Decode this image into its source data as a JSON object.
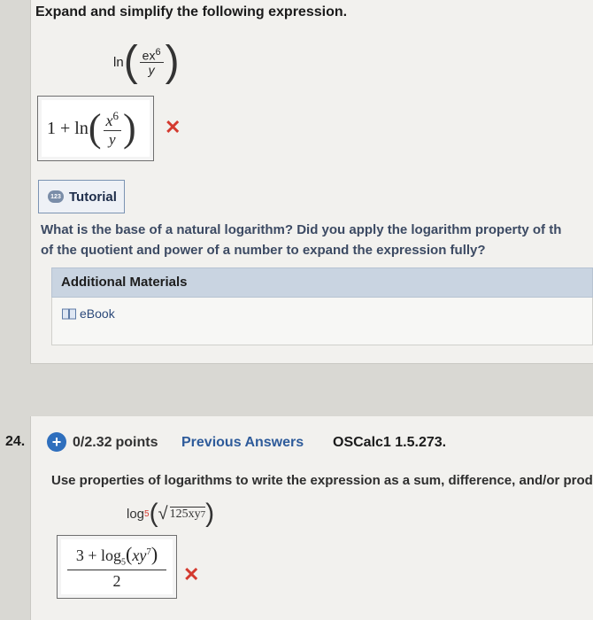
{
  "question23": {
    "heading": "Expand and simplify the following expression.",
    "expression": {
      "fn": "ln",
      "numerator": "ex",
      "exponent": "6",
      "denominator": "y"
    },
    "answer": {
      "prefix": "1 + ln",
      "numerator": "x",
      "exponent": "6",
      "denominator": "y"
    },
    "tutorial_label": "Tutorial",
    "hint_line1": "What is the base of a natural logarithm? Did you apply the logarithm property of th",
    "hint_line2": "of the quotient and power of a number to expand the expression fully?",
    "additional_materials": "Additional Materials",
    "ebook_label": "eBook"
  },
  "question24": {
    "number": "24.",
    "points_a": "0/2.32",
    "points_b": "points",
    "previous_answers": "Previous Answers",
    "source": "OSCalc1 1.5.273.",
    "prompt": "Use properties of logarithms to write the expression as a sum, difference, and/or prod",
    "expression": {
      "fn": "log",
      "base": "5",
      "radicand": "125xy",
      "exponent": "7"
    },
    "answer": {
      "numerator_prefix": "3 + log",
      "base": "5",
      "inner": "xy",
      "exponent": "7",
      "denominator": "2"
    }
  },
  "colors": {
    "incorrect": "#d43a2f",
    "link": "#2e5b9a",
    "header_band": "#c9d4e1"
  },
  "icons": [
    "incorrect-x-icon",
    "tutorial-icon",
    "ebook-icon",
    "plus-circle-icon"
  ]
}
